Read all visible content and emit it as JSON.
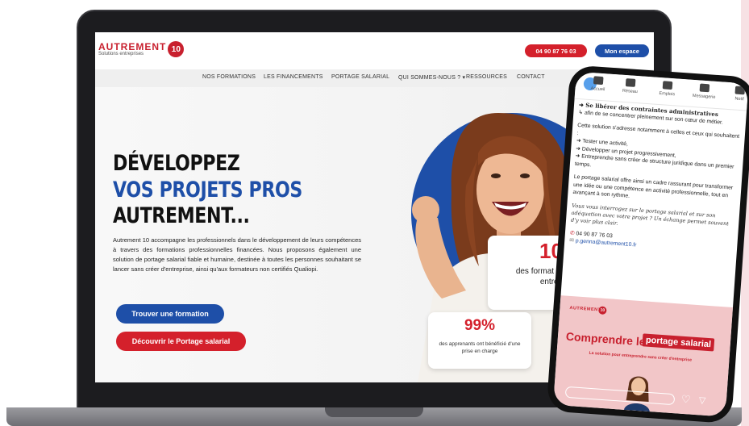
{
  "site": {
    "logo_name": "AUTREMENT",
    "logo_sub": "Solutions entreprises",
    "logo_badge": "10",
    "phone_button": "04 90 87 76 03",
    "space_button": "Mon espace",
    "nav": [
      "NOS FORMATIONS",
      "LES FINANCEMENTS",
      "PORTAGE SALARIAL",
      "QUI SOMMES-NOUS ?",
      "RESSOURCES",
      "CONTACT"
    ],
    "hero_line1": "DÉVELOPPEZ",
    "hero_line2": "VOS PROJETS PROS",
    "hero_line3": "AUTREMENT...",
    "intro": "Autrement 10 accompagne les professionnels dans le développement de leurs compétences à travers des formations professionnelles financées. Nous proposons également une solution de portage salarial fiable et humaine, destinée à toutes les personnes souhaitant se lancer sans créer d'entreprise, ainsi qu'aux formateurs non certifiés Qualiopi.",
    "cta_training": "Trouver une formation",
    "cta_portage": "Découvrir le Portage salarial",
    "stat1_value": "10",
    "stat1_label": "des format et anime entrep",
    "stat2_value": "99%",
    "stat2_label": "des apprenants ont bénéficié d'une prise en charge",
    "colors": {
      "brand_red": "#d4202b",
      "brand_blue": "#1e4fa8"
    }
  },
  "phone": {
    "nav": [
      "Accueil",
      "Réseau",
      "Emplois",
      "Messagerie",
      "Notif"
    ],
    "nav_icons": [
      "home-icon",
      "network-icon",
      "briefcase-icon",
      "message-icon",
      "bell-icon"
    ],
    "line1": "➜ Se libérer des contraintes administratives",
    "line2": "↳ afin de se concentrer pleinement sur son cœur de métier.",
    "para1_intro": "Cette solution s'adresse notamment à celles et ceux qui souhaitent :",
    "bullet1": "➜ Tester une activité,",
    "bullet2": "➜ Développer un projet progressivement,",
    "bullet3": "➜ Entreprendre sans créer de structure juridique dans un premier temps.",
    "para2": "Le portage salarial offre ainsi un cadre rassurant pour transformer une idée ou une compétence en activité professionnelle, tout en avançant à son rythme.",
    "italic": "Vous vous interrogez sur le portage salarial et sur son adéquation avec votre projet ? Un échange permet souvent d'y voir plus clair.",
    "phone": "04 90 87 76 03",
    "email": "p.genna@autrement10.fr",
    "promo_logo": "AUTREMENT",
    "promo_title": "Comprendre le",
    "promo_title_box": "portage salarial",
    "promo_sub": "La solution pour entreprendre sans créer d'entreprise"
  }
}
